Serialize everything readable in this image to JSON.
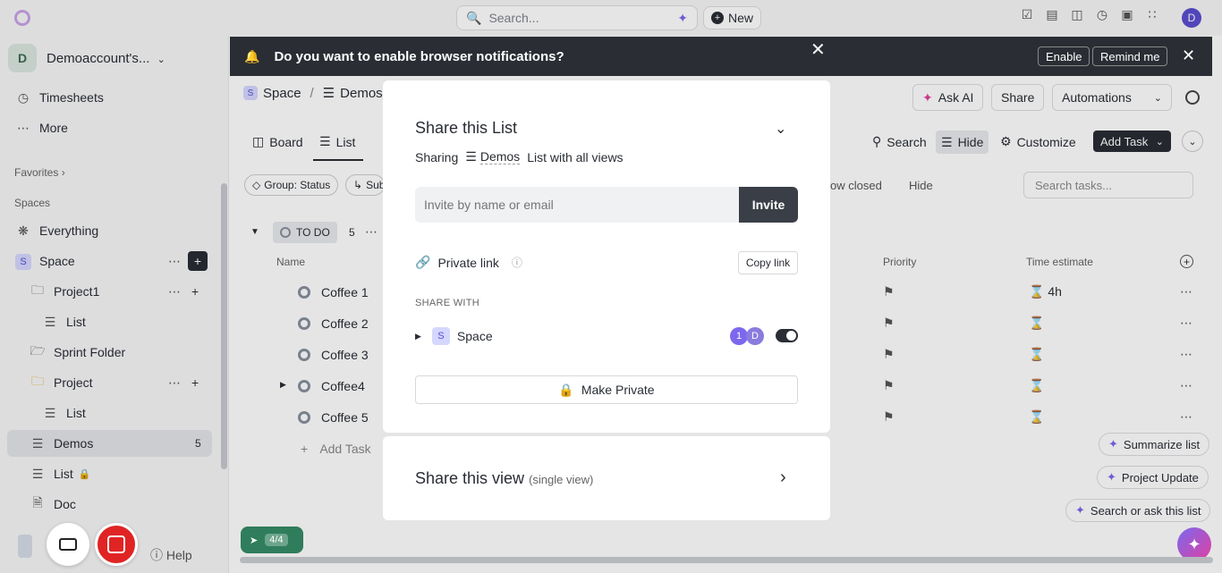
{
  "topbar": {
    "search_placeholder": "Search...",
    "new_label": "New",
    "avatar_letter": "D"
  },
  "sidebar": {
    "workspace_letter": "D",
    "workspace_name": "Demoaccount's...",
    "items": [
      {
        "label": "Timesheets",
        "icon": "clock-icon"
      },
      {
        "label": "More",
        "icon": "more-icon"
      }
    ],
    "favorites_label": "Favorites",
    "spaces_label": "Spaces",
    "tree": [
      {
        "label": "Everything",
        "icon": "everything-icon"
      },
      {
        "label": "Space",
        "icon": "space-icon"
      },
      {
        "label": "Project1",
        "icon": "folder-icon"
      },
      {
        "label": "List",
        "icon": "list-icon"
      },
      {
        "label": "Sprint Folder",
        "icon": "sprint-folder-icon"
      },
      {
        "label": "Project",
        "icon": "folder-icon"
      },
      {
        "label": "List",
        "icon": "list-icon"
      },
      {
        "label": "Demos",
        "icon": "list-icon",
        "count": "5"
      },
      {
        "label": "List",
        "icon": "list-icon"
      },
      {
        "label": "Doc",
        "icon": "doc-icon"
      }
    ],
    "help_label": "Help"
  },
  "notification": {
    "text": "Do you want to enable browser notifications?",
    "enable_label": "Enable",
    "remind_label": "Remind me"
  },
  "header": {
    "breadcrumb_space": "Space",
    "breadcrumb_sep": "/",
    "breadcrumb_list": "Demos",
    "ask_ai_label": "Ask AI",
    "share_label": "Share",
    "automations_label": "Automations"
  },
  "views": {
    "tabs": [
      "Board",
      "List"
    ],
    "search_label": "Search",
    "hide_label": "Hide",
    "customize_label": "Customize",
    "add_task_label": "Add Task"
  },
  "filters": {
    "group_label": "Group: Status",
    "sub_label": "Sub",
    "show_closed_label": "ow closed",
    "hide_label": "Hide",
    "search_placeholder": "Search tasks..."
  },
  "list": {
    "group_status": "TO DO",
    "group_count": "5",
    "col_name": "Name",
    "col_priority": "Priority",
    "col_time": "Time estimate",
    "tasks": [
      {
        "name": "Coffee 1",
        "time": "4h"
      },
      {
        "name": "Coffee 2",
        "time": ""
      },
      {
        "name": "Coffee 3",
        "time": ""
      },
      {
        "name": "Coffee4",
        "time": ""
      },
      {
        "name": "Coffee 5",
        "time": ""
      }
    ],
    "add_task_label": "Add Task"
  },
  "modal": {
    "title": "Share this List",
    "sharing_prefix": "Sharing",
    "sharing_list": "Demos",
    "sharing_suffix": "List with all views",
    "invite_placeholder": "Invite by name or email",
    "invite_label": "Invite",
    "private_link_label": "Private link",
    "copy_link_label": "Copy link",
    "share_with_label": "SHARE WITH",
    "space_letter": "S",
    "space_name": "Space",
    "member_count": "1",
    "member_letter": "D",
    "make_private_label": "Make Private",
    "share_view_title": "Share this view",
    "share_view_sub": "(single view)"
  },
  "ai_chips": {
    "summarize": "Summarize list",
    "project_update": "Project Update",
    "search_ask": "Search or ask this list"
  },
  "rocket": {
    "progress": "4/4"
  },
  "colors": {
    "accent": "#7b68ee",
    "dark": "#292d34",
    "record": "#e02424",
    "green": "#2f7d5b"
  }
}
